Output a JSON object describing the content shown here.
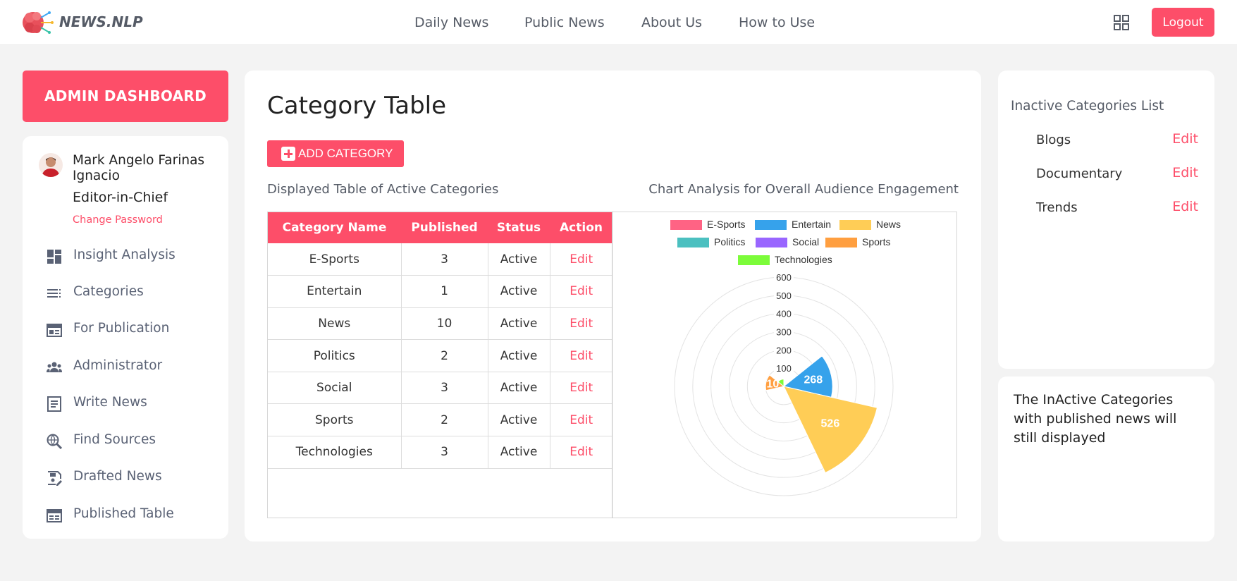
{
  "header": {
    "brand": "NEWS.NLP",
    "nav": [
      "Daily News",
      "Public News",
      "About Us",
      "How to Use"
    ],
    "logout_label": "Logout"
  },
  "sidebar": {
    "banner": "ADMIN DASHBOARD",
    "user": {
      "name": "Mark Angelo Farinas Ignacio",
      "role": "Editor-in-Chief",
      "change_password": "Change Password"
    },
    "items": [
      {
        "label": "Insight Analysis",
        "icon": "dashboard-icon"
      },
      {
        "label": "Categories",
        "icon": "list-icon"
      },
      {
        "label": "For Publication",
        "icon": "calendar-icon"
      },
      {
        "label": "Administrator",
        "icon": "group-icon"
      },
      {
        "label": "Write News",
        "icon": "document-icon"
      },
      {
        "label": "Find Sources",
        "icon": "search-globe-icon"
      },
      {
        "label": "Drafted News",
        "icon": "draft-icon"
      },
      {
        "label": "Published Table",
        "icon": "table-icon"
      }
    ]
  },
  "main": {
    "title": "Category Table",
    "add_button": "ADD CATEGORY",
    "table_caption": "Displayed Table of Active Categories",
    "chart_caption": "Chart Analysis for Overall Audience Engagement",
    "table": {
      "headers": [
        "Category Name",
        "Published",
        "Status",
        "Action"
      ],
      "rows": [
        [
          "E-Sports",
          "3",
          "Active",
          "Edit"
        ],
        [
          "Entertain",
          "1",
          "Active",
          "Edit"
        ],
        [
          "News",
          "10",
          "Active",
          "Edit"
        ],
        [
          "Politics",
          "2",
          "Active",
          "Edit"
        ],
        [
          "Social",
          "3",
          "Active",
          "Edit"
        ],
        [
          "Sports",
          "2",
          "Active",
          "Edit"
        ],
        [
          "Technologies",
          "3",
          "Active",
          "Edit"
        ]
      ]
    }
  },
  "chart_data": {
    "type": "polar-area",
    "categories": [
      "E-Sports",
      "Entertain",
      "News",
      "Politics",
      "Social",
      "Sports",
      "Technologies"
    ],
    "values": [
      4,
      268,
      526,
      3,
      5,
      100,
      40
    ],
    "data_labels": {
      "Entertain": "268",
      "News": "526",
      "Sports": "10"
    },
    "colors": [
      "#ff6384",
      "#36a2eb",
      "#ffcd56",
      "#4bc0c0",
      "#9966ff",
      "#ff9f40",
      "#7cfc3a"
    ],
    "radial_ticks": [
      100,
      200,
      300,
      400,
      500,
      600
    ],
    "rlim": [
      0,
      600
    ],
    "legend": "top"
  },
  "inactive": {
    "title": "Inactive Categories List",
    "items": [
      {
        "name": "Blogs",
        "action": "Edit"
      },
      {
        "name": "Documentary",
        "action": "Edit"
      },
      {
        "name": "Trends",
        "action": "Edit"
      }
    ]
  },
  "note": {
    "text": "The InActive Categories with published news will still displayed"
  }
}
